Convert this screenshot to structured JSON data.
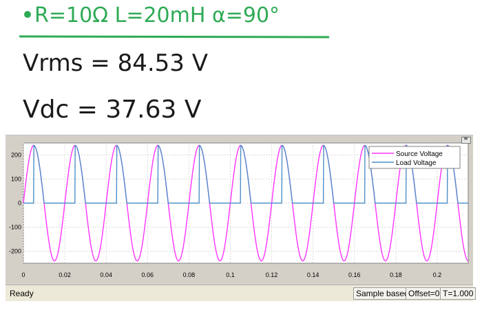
{
  "header": {
    "params": "R=10Ω  L=20mH  α=90°",
    "vrms": "Vrms = 84.53 V",
    "vdc": "Vdc = 37.63 V"
  },
  "colors": {
    "handwriting_green": "#2eaa55",
    "handwriting_dark": "#1a1a1a",
    "plot_bg": "#ffffff",
    "frame_bg": "#d4d0c8",
    "source": "#ff33ff",
    "load": "#4f8fc9"
  },
  "chart_data": {
    "type": "line",
    "title": "",
    "xlabel": "",
    "ylabel": "",
    "xlim": [
      0,
      0.215
    ],
    "ylim": [
      -250,
      250
    ],
    "x_ticks": [
      "0",
      "0.02",
      "0.04",
      "0.06",
      "0.08",
      "0.1",
      "0.12",
      "0.14",
      "0.16",
      "0.18",
      "0.2"
    ],
    "y_ticks": [
      "200",
      "100",
      "0",
      "-100",
      "-200"
    ],
    "grid": true,
    "legend_position": "top-right",
    "series": [
      {
        "name": "Source Voltage",
        "color": "#ff33ff",
        "amplitude": 240,
        "frequency_hz": 50
      },
      {
        "name": "Load Voltage",
        "color": "#4f8fc9",
        "firing_angle_deg": 90,
        "extinction_angle_deg": 180
      }
    ]
  },
  "status": {
    "ready": "Ready",
    "mode": "Sample based",
    "offset": "Offset=0",
    "time": "T=1.000"
  }
}
